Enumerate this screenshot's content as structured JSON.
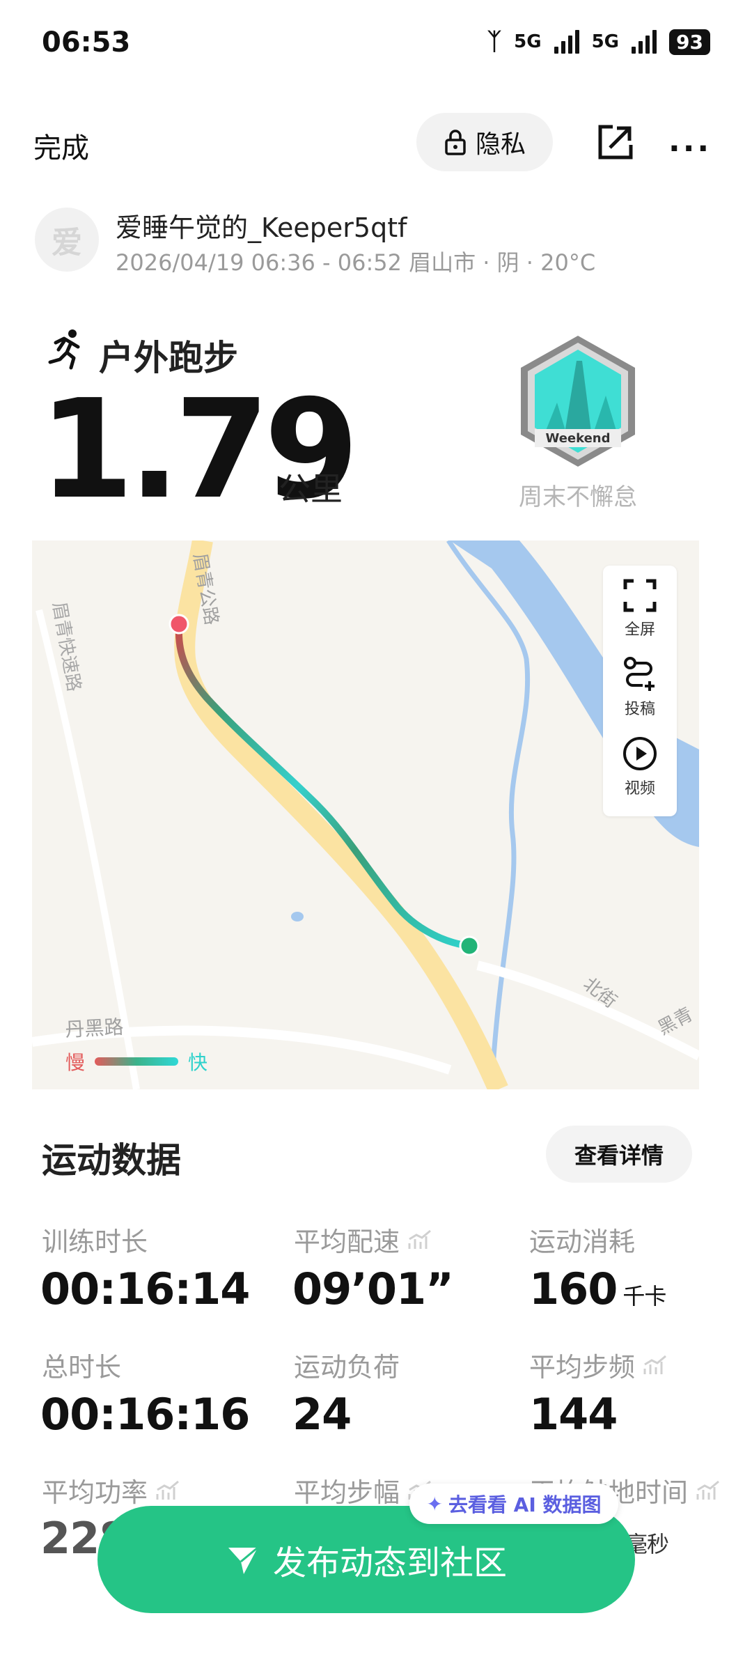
{
  "status_bar": {
    "time": "06:53",
    "net1": "5G",
    "net2": "5G",
    "battery": "93"
  },
  "nav": {
    "done": "完成",
    "privacy": "隐私"
  },
  "user": {
    "avatar_char": "爱",
    "name": "爱睡午觉的_Keeper5qtf",
    "meta": "2026/04/19 06:36 - 06:52 眉山市 · 阴 · 20°C"
  },
  "activity": {
    "type": "户外跑步",
    "distance": "1.79",
    "unit": "公里",
    "badge_text": "Weekend",
    "badge_label": "周末不懈怠"
  },
  "map": {
    "labels": {
      "road1": "眉青公路",
      "road2": "眉青快速路",
      "road3": "丹黑路",
      "road4": "北街",
      "road5": "黑青"
    },
    "controls": {
      "fullscreen": "全屏",
      "submit": "投稿",
      "video": "视频"
    },
    "legend": {
      "slow": "慢",
      "fast": "快"
    }
  },
  "stats": {
    "title": "运动数据",
    "detail_button": "查看详情",
    "items": [
      {
        "label": "训练时长",
        "value": "00:16:14",
        "unit": ""
      },
      {
        "label": "平均配速",
        "value": "09’01”",
        "unit": ""
      },
      {
        "label": "运动消耗",
        "value": "160",
        "unit": "千卡"
      },
      {
        "label": "总时长",
        "value": "00:16:16",
        "unit": ""
      },
      {
        "label": "运动负荷",
        "value": "24",
        "unit": ""
      },
      {
        "label": "平均步频",
        "value": "144",
        "unit": ""
      },
      {
        "label": "平均功率",
        "value": "228",
        "unit": ""
      },
      {
        "label": "平均步幅",
        "value": "",
        "unit": ""
      },
      {
        "label": "平均触地时间",
        "value": "",
        "unit": "毫秒"
      }
    ]
  },
  "ai_pill": "去看看 AI 数据图",
  "publish": "发布动态到社区",
  "colors": {
    "accent": "#25c486",
    "start_dot": "#f0566a",
    "end_dot": "#22b478",
    "river": "#a5c8ee",
    "road": "#fbe3a2"
  }
}
